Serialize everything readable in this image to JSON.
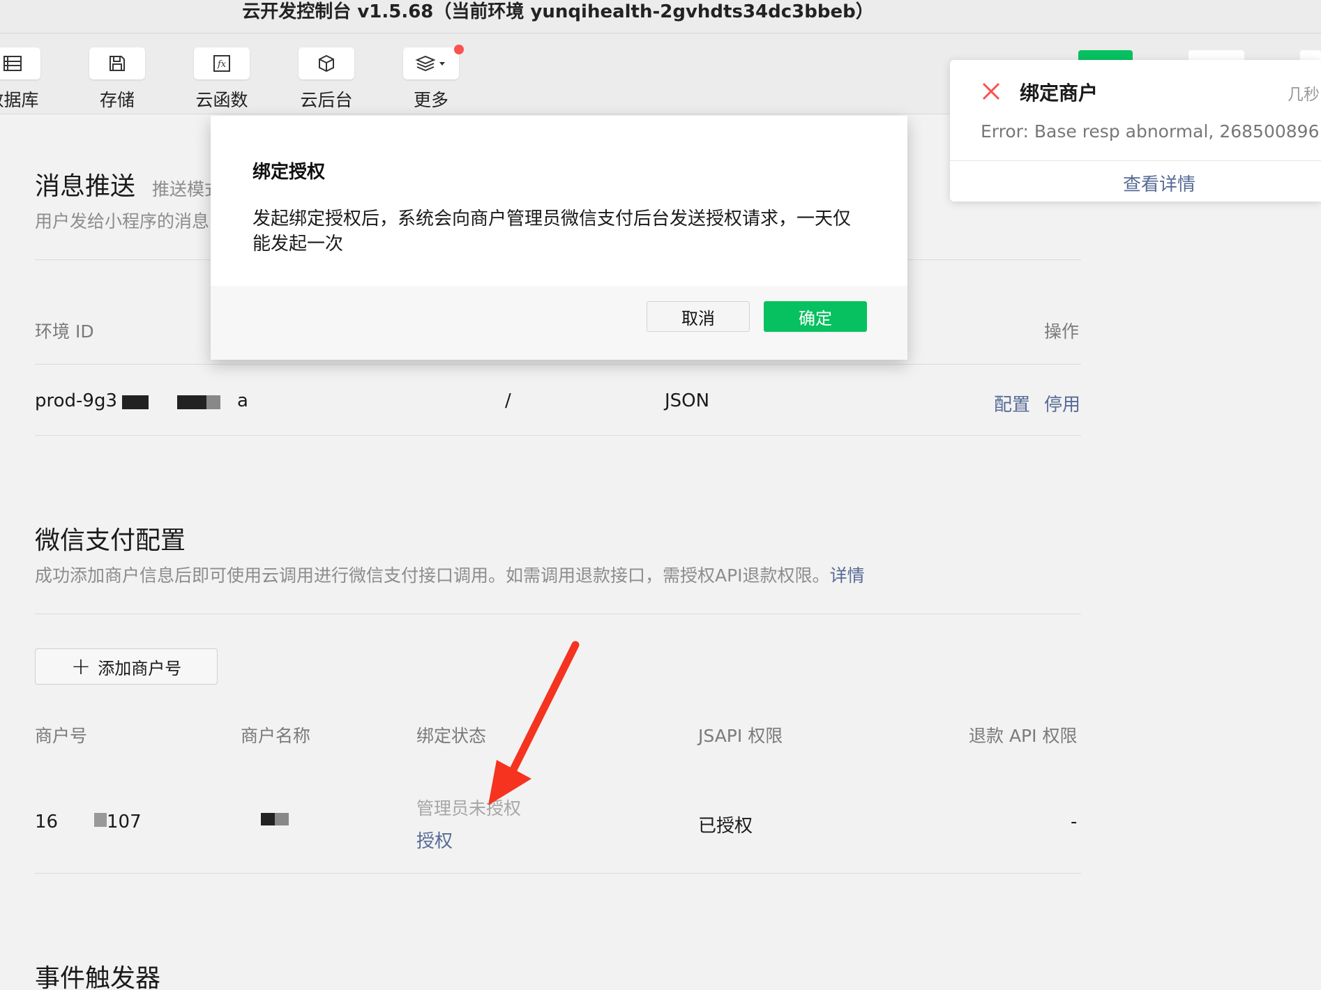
{
  "window": {
    "title": "云开发控制台 v1.5.68（当前环境 yunqihealth-2gvhdts34dc3bbeb）"
  },
  "toolbar": {
    "items": [
      {
        "label": "数据库",
        "icon": "database-icon"
      },
      {
        "label": "存储",
        "icon": "storage-icon"
      },
      {
        "label": "云函数",
        "icon": "function-icon"
      },
      {
        "label": "云后台",
        "icon": "cube-icon"
      },
      {
        "label": "更多",
        "icon": "layers-icon"
      }
    ],
    "badge_color": "#fa5151"
  },
  "message_push": {
    "title": "消息推送",
    "subtitle_tab": "推送模式",
    "description": "用户发给小程序的消息",
    "table": {
      "headers": {
        "env_id": "环境 ID",
        "actions": "操作"
      },
      "row": {
        "env_id": "prod-9g3",
        "env_id_tail": "a",
        "path": "/",
        "format": "JSON",
        "action_config": "配置",
        "action_disable": "停用"
      }
    }
  },
  "wechat_pay": {
    "title": "微信支付配置",
    "description": "成功添加商户信息后即可使用云调用进行微信支付接口调用。如需调用退款接口，需授权API退款权限。",
    "details_link": "详情",
    "add_button": "添加商户号",
    "table": {
      "headers": [
        "商户号",
        "商户名称",
        "绑定状态",
        "JSAPI 权限",
        "退款 API 权限"
      ],
      "row": {
        "merchant_id_prefix": "16",
        "merchant_id_suffix": "107",
        "binding_status": "管理员未授权",
        "authorize_link": "授权",
        "jsapi": "已授权",
        "refund": "-"
      }
    }
  },
  "event_trigger": {
    "title": "事件触发器"
  },
  "modal": {
    "title": "绑定授权",
    "body": "发起绑定授权后，系统会向商户管理员微信支付后台发送授权请求，一天仅能发起一次",
    "cancel": "取消",
    "confirm": "确定"
  },
  "toast": {
    "title": "绑定商户",
    "time": "几秒",
    "message": "Error: Base resp abnormal, 268500896",
    "link": "查看详情"
  },
  "colors": {
    "primary_green": "#07c160",
    "link_blue": "#576b95",
    "error_red": "#fa5151",
    "arrow_red": "#f5331f"
  }
}
